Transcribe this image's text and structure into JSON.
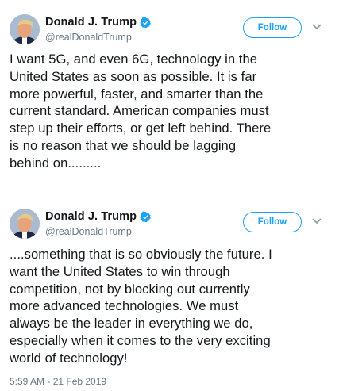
{
  "tweets": [
    {
      "author": {
        "display_name": "Donald J. Trump",
        "handle": "@realDonaldTrump",
        "verified": true
      },
      "follow_label": "Follow",
      "text_lines": [
        "I want 5G, and even 6G, technology in the",
        "United States as soon as possible. It is far",
        "more powerful, faster, and smarter than the",
        "current standard. American companies must",
        "step up their efforts, or get left behind. There",
        "is no reason that we should be lagging",
        "behind on........."
      ]
    },
    {
      "author": {
        "display_name": "Donald J. Trump",
        "handle": "@realDonaldTrump",
        "verified": true
      },
      "follow_label": "Follow",
      "text_lines": [
        "....something that is so obviously the future. I",
        "want the United States to win through",
        "competition, not by blocking out currently",
        "more advanced technologies. We must",
        "always be the leader in everything we do,",
        "especially when it comes to the very exciting",
        "world of technology!"
      ],
      "timestamp": "5:59 AM - 21 Feb 2019"
    }
  ],
  "colors": {
    "accent": "#1da1f2",
    "text": "#14171a",
    "muted": "#657786"
  },
  "icons": {
    "verified": "verified-badge-icon",
    "caret": "chevron-down-icon"
  }
}
